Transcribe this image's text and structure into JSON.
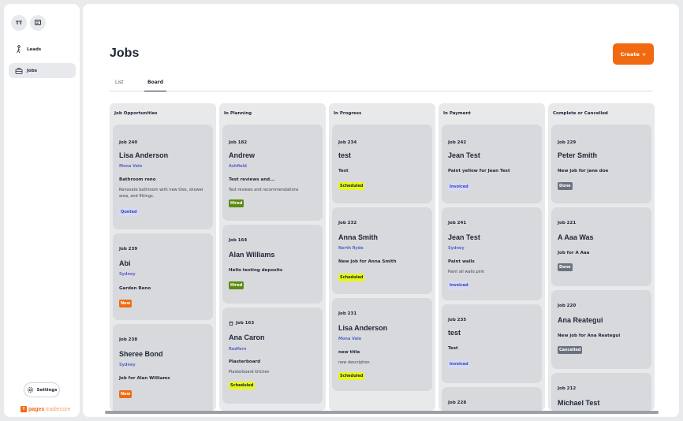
{
  "sidebar": {
    "avatar": "TT",
    "nav": [
      {
        "label": "Leads",
        "icon": "person-walking-icon"
      },
      {
        "label": "Jobs",
        "icon": "toolbox-icon"
      }
    ],
    "settings_label": "Settings",
    "logo": {
      "mark": "Y",
      "brand": "pages",
      "sub": "tradiecore"
    }
  },
  "header": {
    "title": "Jobs",
    "create_label": "Create",
    "create_icon": "+"
  },
  "tabs": [
    {
      "label": "List"
    },
    {
      "label": "Board"
    }
  ],
  "columns": [
    {
      "title": "Job Opportunities",
      "cards": [
        {
          "id": "Job 240",
          "customer": "Lisa Anderson",
          "location": "Mona Vale",
          "title": "Bathroom reno",
          "desc": "Renovate bathroom with new tiles, shower area, and fittings.",
          "status": "Quoted"
        },
        {
          "id": "Job 239",
          "customer": "Abi",
          "location": "Sydney",
          "title": "Garden Reno",
          "desc": "",
          "status": "New"
        },
        {
          "id": "Job 238",
          "customer": "Sheree Bond",
          "location": "Sydney",
          "title": "Job for Alan Williams",
          "desc": "",
          "status": "New"
        }
      ]
    },
    {
      "title": "In Planning",
      "cards": [
        {
          "id": "Job 182",
          "customer": "Andrew",
          "location": "Ashfield",
          "title": "Test reviews and...",
          "desc": "Test reviews and recommendations",
          "status": "Hired"
        },
        {
          "id": "Job 164",
          "customer": "Alan Williams",
          "location": "",
          "title": "Hello testing deposits",
          "desc": "",
          "status": "Hired"
        },
        {
          "id": "Job 163",
          "customer": "Ana Caron",
          "location": "Redfern",
          "title": "Plasterboard",
          "desc": "Plasterboard kitchen",
          "status": "Scheduled"
        }
      ]
    },
    {
      "title": "In Progress",
      "cards": [
        {
          "id": "Job 234",
          "customer": "test",
          "location": "",
          "title": "Test",
          "desc": "",
          "status": "Scheduled"
        },
        {
          "id": "Job 232",
          "customer": "Anna Smith",
          "location": "North Ryde",
          "title": "New job for Anna Smith",
          "desc": "",
          "status": "Scheduled"
        },
        {
          "id": "Job 231",
          "customer": "Lisa Anderson",
          "location": "Mona Vale",
          "title": "new title",
          "desc": "new description",
          "status": "Scheduled"
        }
      ]
    },
    {
      "title": "In Payment",
      "cards": [
        {
          "id": "Job 242",
          "customer": "Jean Test",
          "location": "",
          "title": "Paint yellow for Jean Test",
          "desc": "",
          "status": "Invoiced"
        },
        {
          "id": "Job 241",
          "customer": "Jean Test",
          "location": "Sydney",
          "title": "Paint walls",
          "desc": "Paint all walls pink",
          "status": "Invoiced"
        },
        {
          "id": "Job 235",
          "customer": "test",
          "location": "",
          "title": "Test",
          "desc": "",
          "status": "Invoiced"
        },
        {
          "id": "Job 228",
          "customer": "",
          "location": "",
          "title": "",
          "desc": "",
          "status": ""
        }
      ]
    },
    {
      "title": "Complete or Cancelled",
      "cards": [
        {
          "id": "Job 229",
          "customer": "Peter Smith",
          "location": "",
          "title": "New job for jane doe",
          "desc": "",
          "status": "Done"
        },
        {
          "id": "Job 221",
          "customer": "A Aaa Was",
          "location": "",
          "title": "Job for A Aaa",
          "desc": "",
          "status": "Done"
        },
        {
          "id": "Job 220",
          "customer": "Ana Reategui",
          "location": "",
          "title": "New job for Ana Reategui",
          "desc": "",
          "status": "Cancelled"
        },
        {
          "id": "Job 212",
          "customer": "Michael Test",
          "location": "",
          "title": "",
          "desc": "",
          "status": ""
        }
      ]
    }
  ],
  "colors": {
    "accent": "#f26a0f",
    "hired": "#5c8a10",
    "scheduled": "#e6f71e",
    "link": "#5a67c8"
  }
}
